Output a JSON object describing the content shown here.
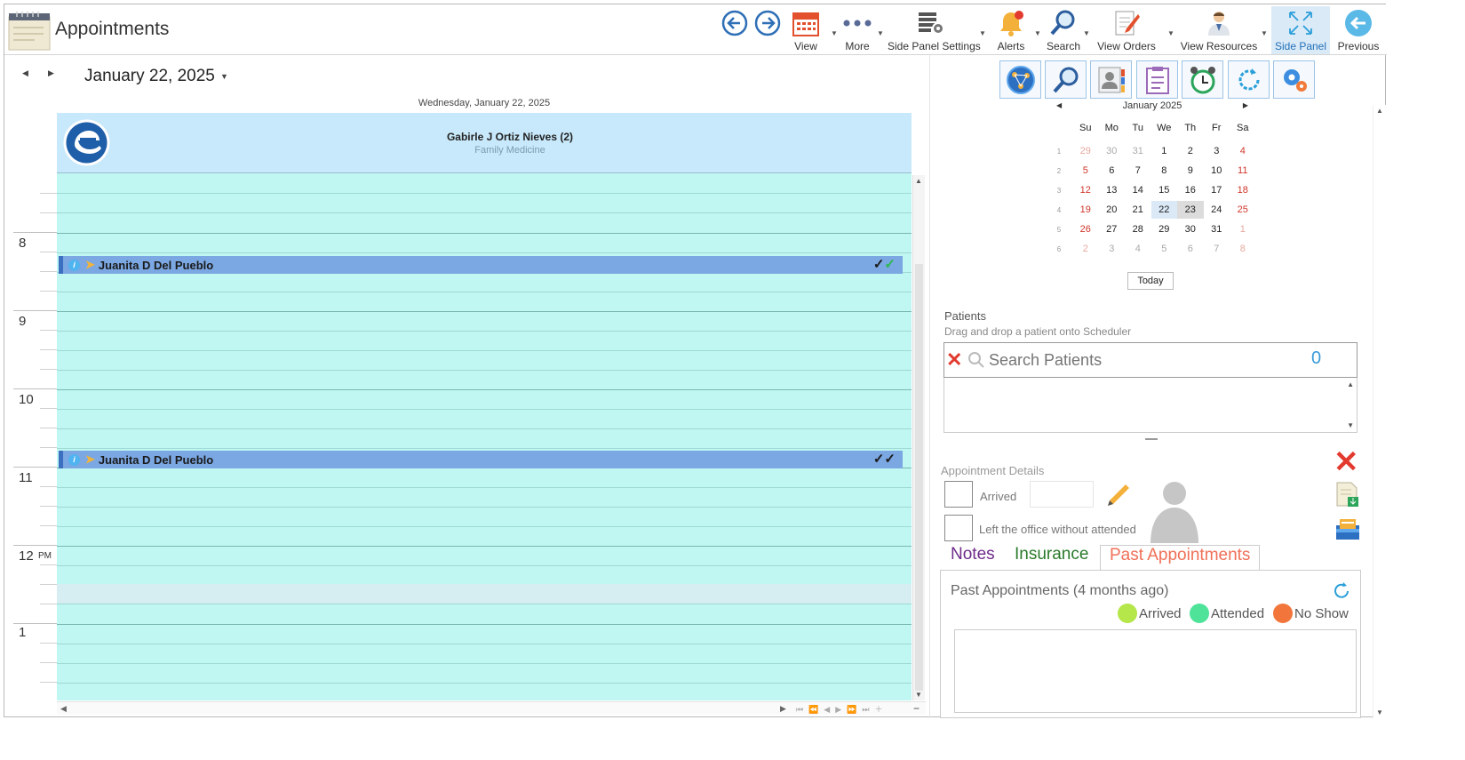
{
  "app": {
    "title": "Appointments"
  },
  "toolbar": {
    "view": "View",
    "more": "More",
    "side_panel_settings": "Side Panel Settings",
    "alerts": "Alerts",
    "search": "Search",
    "view_orders": "View Orders",
    "view_resources": "View Resources",
    "side_panel": "Side Panel",
    "previous": "Previous"
  },
  "scheduler": {
    "date_heading": "January 22, 2025",
    "day_header": "Wednesday, January 22, 2025",
    "resource": {
      "name": "Gabirle J Ortiz Nieves (2)",
      "specialty": "Family Medicine"
    },
    "hours": [
      {
        "label": "8",
        "suffix": ""
      },
      {
        "label": "9",
        "suffix": ""
      },
      {
        "label": "10",
        "suffix": ""
      },
      {
        "label": "11",
        "suffix": ""
      },
      {
        "label": "12",
        "suffix": "PM"
      },
      {
        "label": "1",
        "suffix": ""
      }
    ],
    "appointments": [
      {
        "patient": "Juanita D Del Pueblo",
        "time": "8:15",
        "status_icons": "✓✓"
      },
      {
        "patient": "Juanita D Del Pueblo",
        "time": "10:45",
        "status_icons": "✓✓"
      }
    ]
  },
  "mini_calendar": {
    "month": "January 2025",
    "weekdays": [
      "Su",
      "Mo",
      "Tu",
      "We",
      "Th",
      "Fr",
      "Sa"
    ],
    "weeks": [
      {
        "wk": "1",
        "days": [
          "29",
          "30",
          "31",
          "1",
          "2",
          "3",
          "4"
        ]
      },
      {
        "wk": "2",
        "days": [
          "5",
          "6",
          "7",
          "8",
          "9",
          "10",
          "11"
        ]
      },
      {
        "wk": "3",
        "days": [
          "12",
          "13",
          "14",
          "15",
          "16",
          "17",
          "18"
        ]
      },
      {
        "wk": "4",
        "days": [
          "19",
          "20",
          "21",
          "22",
          "23",
          "24",
          "25"
        ]
      },
      {
        "wk": "5",
        "days": [
          "26",
          "27",
          "28",
          "29",
          "30",
          "31",
          "1"
        ]
      },
      {
        "wk": "6",
        "days": [
          "2",
          "3",
          "4",
          "5",
          "6",
          "7",
          "8"
        ]
      }
    ],
    "selected": "22",
    "today": "23",
    "today_button": "Today"
  },
  "patients": {
    "title": "Patients",
    "hint": "Drag and drop a patient onto Scheduler",
    "search_placeholder": "Search Patients",
    "count": "0"
  },
  "appointment_details": {
    "title": "Appointment Details",
    "arrived_label": "Arrived",
    "left_label": "Left the office without attended"
  },
  "tabs": {
    "notes": "Notes",
    "insurance": "Insurance",
    "past": "Past Appointments"
  },
  "past": {
    "title": "Past Appointments (4 months ago)",
    "legend": [
      {
        "label": "Arrived",
        "color": "#b5e64a"
      },
      {
        "label": "Attended",
        "color": "#4fe39a"
      },
      {
        "label": "No Show",
        "color": "#f2763b"
      }
    ]
  },
  "colors": {
    "grid": "#c0f7f2",
    "appointment": "#7ba7e2",
    "accent": "#1f6fb8",
    "weekend": "#d0362a"
  }
}
